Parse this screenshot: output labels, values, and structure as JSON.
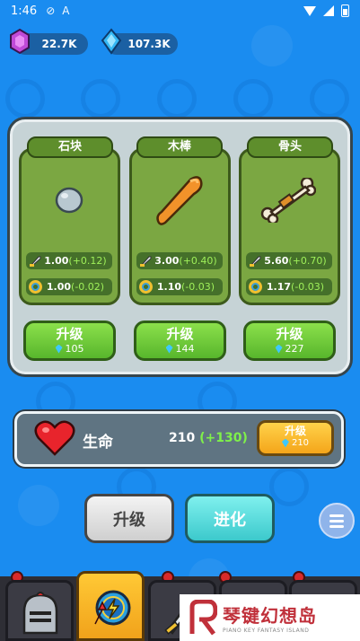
{
  "status_bar": {
    "time": "1:46"
  },
  "currency": {
    "purple_gems": "22.7K",
    "blue_gems": "107.3K"
  },
  "weapons": [
    {
      "name": "石块",
      "attack": "1.00",
      "attack_delta": "(+0.12)",
      "speed": "1.00",
      "speed_delta": "(-0.02)",
      "upgrade_label": "升级",
      "upgrade_cost": "105"
    },
    {
      "name": "木棒",
      "attack": "3.00",
      "attack_delta": "(+0.40)",
      "speed": "1.10",
      "speed_delta": "(-0.03)",
      "upgrade_label": "升级",
      "upgrade_cost": "144"
    },
    {
      "name": "骨头",
      "attack": "5.60",
      "attack_delta": "(+0.70)",
      "speed": "1.17",
      "speed_delta": "(-0.03)",
      "upgrade_label": "升级",
      "upgrade_cost": "227"
    }
  ],
  "life": {
    "label": "生命",
    "value": "210",
    "delta": "(+130)",
    "upgrade_label": "升级",
    "upgrade_cost": "210"
  },
  "actions": {
    "upgrade": "升级",
    "evolve": "进化"
  },
  "watermark": {
    "title": "琴键幻想岛",
    "subtitle": "PIANO KEY FANTASY ISLAND"
  },
  "colors": {
    "background": "#1a8cf0",
    "green_button": "#58b62c",
    "orange_button": "#f4a51a",
    "teal_button": "#3cc9cc",
    "delta_green": "#9ff05a"
  },
  "icons": [
    "purple-gem-icon",
    "blue-diamond-icon",
    "heart-icon",
    "sword-icon",
    "ring-icon",
    "menu-icon",
    "knight-helmet-icon"
  ]
}
